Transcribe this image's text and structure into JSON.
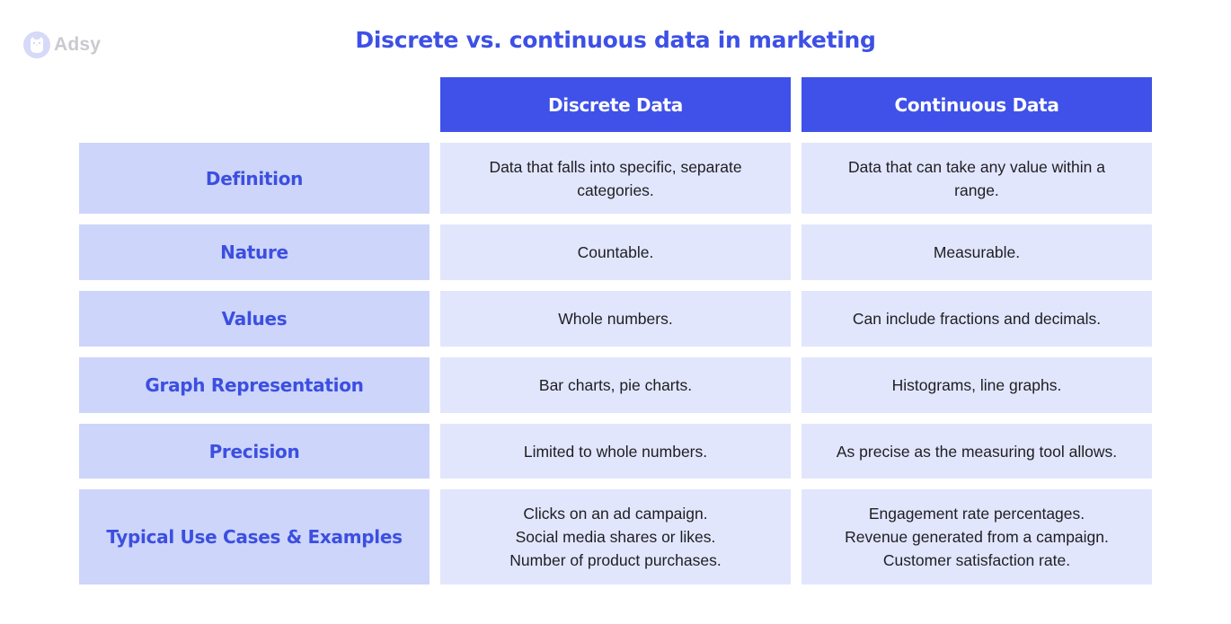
{
  "brand": {
    "name": "Adsy",
    "icon": "owl-logo-icon",
    "colors": {
      "logo_circle": "#d6d9f7",
      "logo_text": "#c9c9cf"
    }
  },
  "title": "Discrete vs. continuous data in marketing",
  "colors": {
    "accent": "#3f51e8",
    "row_label_bg": "#cdd5fb",
    "value_bg": "#e2e6fc",
    "text_dark": "#1e1e24"
  },
  "table": {
    "columns": [
      "Discrete Data",
      "Continuous Data"
    ],
    "rows": [
      {
        "label": "Definition",
        "discrete": [
          "Data that falls into specific, separate",
          "categories."
        ],
        "continuous": [
          "Data that can take any value within a",
          "range."
        ]
      },
      {
        "label": "Nature",
        "discrete": [
          "Countable."
        ],
        "continuous": [
          "Measurable."
        ]
      },
      {
        "label": "Values",
        "discrete": [
          "Whole numbers."
        ],
        "continuous": [
          "Can include fractions and decimals."
        ]
      },
      {
        "label": "Graph Representation",
        "discrete": [
          "Bar charts, pie charts."
        ],
        "continuous": [
          "Histograms, line graphs."
        ]
      },
      {
        "label": "Precision",
        "discrete": [
          "Limited to whole numbers."
        ],
        "continuous": [
          "As precise as the measuring tool allows."
        ]
      },
      {
        "label": "Typical Use Cases & Examples",
        "discrete": [
          "Clicks on an ad campaign.",
          "Social media shares or likes.",
          "Number of product purchases."
        ],
        "continuous": [
          "Engagement rate percentages.",
          "Revenue generated from a campaign.",
          "Customer satisfaction rate."
        ]
      }
    ]
  }
}
